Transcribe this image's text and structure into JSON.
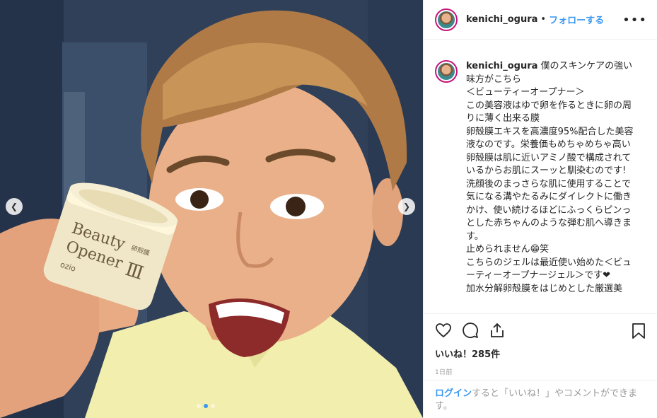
{
  "photo": {
    "jar_text": {
      "line1": "Beauty",
      "line2": "Opener",
      "roman": "Ⅲ",
      "small_kanji": "卵殻膜",
      "brand": "ozio"
    },
    "prev_icon": "chevron-left-icon",
    "next_icon": "chevron-right-icon",
    "carousel_dots": 3,
    "active_dot": 1
  },
  "header": {
    "username": "kenichi_ogura",
    "separator": "•",
    "follow_label": "フォローする",
    "more_label": "•••"
  },
  "caption": {
    "username": "kenichi_ogura",
    "text": " 僕のスキンケアの強い味方がこちら\n＜ビューティーオープナー＞\nこの美容液はゆで卵を作るときに卵の周りに薄く出来る膜\n卵殻膜エキスを高濃度95%配合した美容液なのです。栄養価もめちゃめちゃ高い卵殻膜は肌に近いアミノ酸で構成されているからお肌にスーッと馴染むのです!\n洗顔後のまっさらな肌に使用することで気になる溝やたるみにダイレクトに働きかけ、使い続けるほどにふっくらピンっとした赤ちゃんのような弾む肌へ導きます。\n止められません😁笑\nこちらのジェルは最近使い始めた＜ビューティーオープナージェル＞です❤\n加水分解卵殻膜をはじめとした厳選美"
  },
  "actions": {
    "like_icon": "heart-icon",
    "comment_icon": "comment-icon",
    "share_icon": "share-icon",
    "save_icon": "bookmark-icon",
    "likes_text": "いいね！285件",
    "timestamp": "1日前"
  },
  "login": {
    "link_label": "ログイン",
    "rest_text": "すると「いいね！」やコメントができます。"
  },
  "colors": {
    "link_blue": "#3897f0",
    "avatar_ring": "#c6147a",
    "divider": "#efefef"
  }
}
